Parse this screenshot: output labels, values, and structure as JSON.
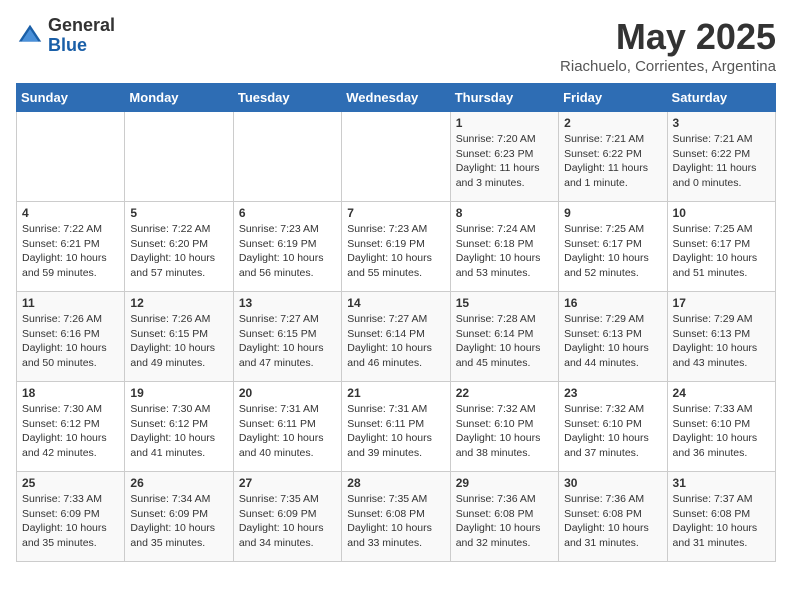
{
  "logo": {
    "general": "General",
    "blue": "Blue"
  },
  "title": {
    "month_year": "May 2025",
    "location": "Riachuelo, Corrientes, Argentina"
  },
  "days_of_week": [
    "Sunday",
    "Monday",
    "Tuesday",
    "Wednesday",
    "Thursday",
    "Friday",
    "Saturday"
  ],
  "weeks": [
    [
      {
        "num": "",
        "info": ""
      },
      {
        "num": "",
        "info": ""
      },
      {
        "num": "",
        "info": ""
      },
      {
        "num": "",
        "info": ""
      },
      {
        "num": "1",
        "info": "Sunrise: 7:20 AM\nSunset: 6:23 PM\nDaylight: 11 hours\nand 3 minutes."
      },
      {
        "num": "2",
        "info": "Sunrise: 7:21 AM\nSunset: 6:22 PM\nDaylight: 11 hours\nand 1 minute."
      },
      {
        "num": "3",
        "info": "Sunrise: 7:21 AM\nSunset: 6:22 PM\nDaylight: 11 hours\nand 0 minutes."
      }
    ],
    [
      {
        "num": "4",
        "info": "Sunrise: 7:22 AM\nSunset: 6:21 PM\nDaylight: 10 hours\nand 59 minutes."
      },
      {
        "num": "5",
        "info": "Sunrise: 7:22 AM\nSunset: 6:20 PM\nDaylight: 10 hours\nand 57 minutes."
      },
      {
        "num": "6",
        "info": "Sunrise: 7:23 AM\nSunset: 6:19 PM\nDaylight: 10 hours\nand 56 minutes."
      },
      {
        "num": "7",
        "info": "Sunrise: 7:23 AM\nSunset: 6:19 PM\nDaylight: 10 hours\nand 55 minutes."
      },
      {
        "num": "8",
        "info": "Sunrise: 7:24 AM\nSunset: 6:18 PM\nDaylight: 10 hours\nand 53 minutes."
      },
      {
        "num": "9",
        "info": "Sunrise: 7:25 AM\nSunset: 6:17 PM\nDaylight: 10 hours\nand 52 minutes."
      },
      {
        "num": "10",
        "info": "Sunrise: 7:25 AM\nSunset: 6:17 PM\nDaylight: 10 hours\nand 51 minutes."
      }
    ],
    [
      {
        "num": "11",
        "info": "Sunrise: 7:26 AM\nSunset: 6:16 PM\nDaylight: 10 hours\nand 50 minutes."
      },
      {
        "num": "12",
        "info": "Sunrise: 7:26 AM\nSunset: 6:15 PM\nDaylight: 10 hours\nand 49 minutes."
      },
      {
        "num": "13",
        "info": "Sunrise: 7:27 AM\nSunset: 6:15 PM\nDaylight: 10 hours\nand 47 minutes."
      },
      {
        "num": "14",
        "info": "Sunrise: 7:27 AM\nSunset: 6:14 PM\nDaylight: 10 hours\nand 46 minutes."
      },
      {
        "num": "15",
        "info": "Sunrise: 7:28 AM\nSunset: 6:14 PM\nDaylight: 10 hours\nand 45 minutes."
      },
      {
        "num": "16",
        "info": "Sunrise: 7:29 AM\nSunset: 6:13 PM\nDaylight: 10 hours\nand 44 minutes."
      },
      {
        "num": "17",
        "info": "Sunrise: 7:29 AM\nSunset: 6:13 PM\nDaylight: 10 hours\nand 43 minutes."
      }
    ],
    [
      {
        "num": "18",
        "info": "Sunrise: 7:30 AM\nSunset: 6:12 PM\nDaylight: 10 hours\nand 42 minutes."
      },
      {
        "num": "19",
        "info": "Sunrise: 7:30 AM\nSunset: 6:12 PM\nDaylight: 10 hours\nand 41 minutes."
      },
      {
        "num": "20",
        "info": "Sunrise: 7:31 AM\nSunset: 6:11 PM\nDaylight: 10 hours\nand 40 minutes."
      },
      {
        "num": "21",
        "info": "Sunrise: 7:31 AM\nSunset: 6:11 PM\nDaylight: 10 hours\nand 39 minutes."
      },
      {
        "num": "22",
        "info": "Sunrise: 7:32 AM\nSunset: 6:10 PM\nDaylight: 10 hours\nand 38 minutes."
      },
      {
        "num": "23",
        "info": "Sunrise: 7:32 AM\nSunset: 6:10 PM\nDaylight: 10 hours\nand 37 minutes."
      },
      {
        "num": "24",
        "info": "Sunrise: 7:33 AM\nSunset: 6:10 PM\nDaylight: 10 hours\nand 36 minutes."
      }
    ],
    [
      {
        "num": "25",
        "info": "Sunrise: 7:33 AM\nSunset: 6:09 PM\nDaylight: 10 hours\nand 35 minutes."
      },
      {
        "num": "26",
        "info": "Sunrise: 7:34 AM\nSunset: 6:09 PM\nDaylight: 10 hours\nand 35 minutes."
      },
      {
        "num": "27",
        "info": "Sunrise: 7:35 AM\nSunset: 6:09 PM\nDaylight: 10 hours\nand 34 minutes."
      },
      {
        "num": "28",
        "info": "Sunrise: 7:35 AM\nSunset: 6:08 PM\nDaylight: 10 hours\nand 33 minutes."
      },
      {
        "num": "29",
        "info": "Sunrise: 7:36 AM\nSunset: 6:08 PM\nDaylight: 10 hours\nand 32 minutes."
      },
      {
        "num": "30",
        "info": "Sunrise: 7:36 AM\nSunset: 6:08 PM\nDaylight: 10 hours\nand 31 minutes."
      },
      {
        "num": "31",
        "info": "Sunrise: 7:37 AM\nSunset: 6:08 PM\nDaylight: 10 hours\nand 31 minutes."
      }
    ]
  ]
}
